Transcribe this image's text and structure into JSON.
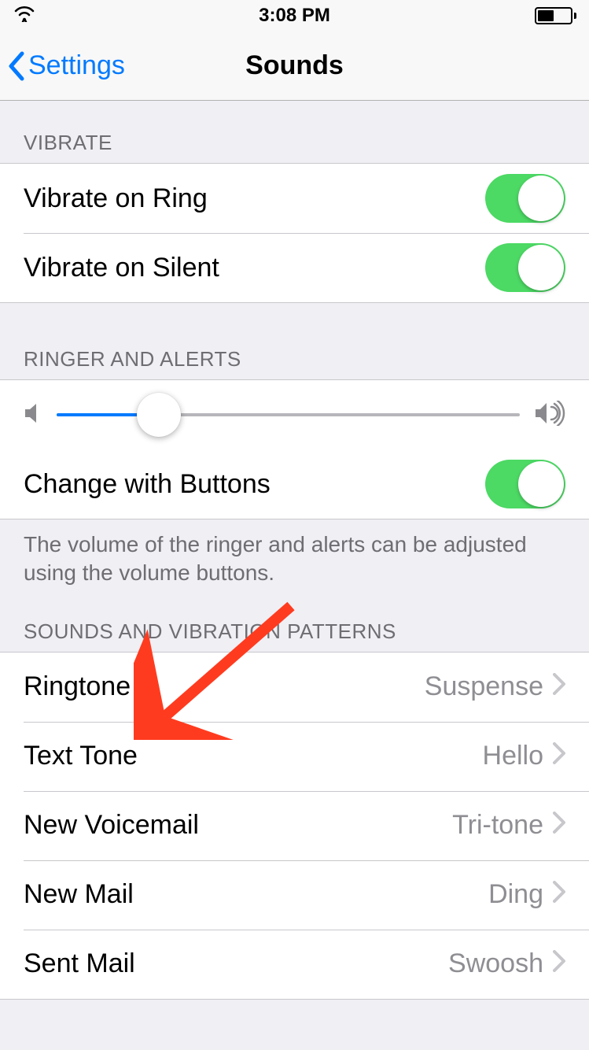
{
  "status": {
    "time": "3:08 PM",
    "battery_pct": 45
  },
  "nav": {
    "back_label": "Settings",
    "title": "Sounds"
  },
  "sections": {
    "vibrate": {
      "header": "VIBRATE",
      "rows": [
        {
          "label": "Vibrate on Ring",
          "on": true
        },
        {
          "label": "Vibrate on Silent",
          "on": true
        }
      ]
    },
    "ringer": {
      "header": "RINGER AND ALERTS",
      "slider_pct": 22,
      "change_buttons": {
        "label": "Change with Buttons",
        "on": true
      },
      "footer": "The volume of the ringer and alerts can be adjusted using the volume buttons."
    },
    "patterns": {
      "header": "SOUNDS AND VIBRATION PATTERNS",
      "rows": [
        {
          "label": "Ringtone",
          "value": "Suspense"
        },
        {
          "label": "Text Tone",
          "value": "Hello"
        },
        {
          "label": "New Voicemail",
          "value": "Tri-tone"
        },
        {
          "label": "New Mail",
          "value": "Ding"
        },
        {
          "label": "Sent Mail",
          "value": "Swoosh"
        }
      ]
    }
  },
  "annotation": {
    "arrow_color": "#ff3b1f"
  }
}
